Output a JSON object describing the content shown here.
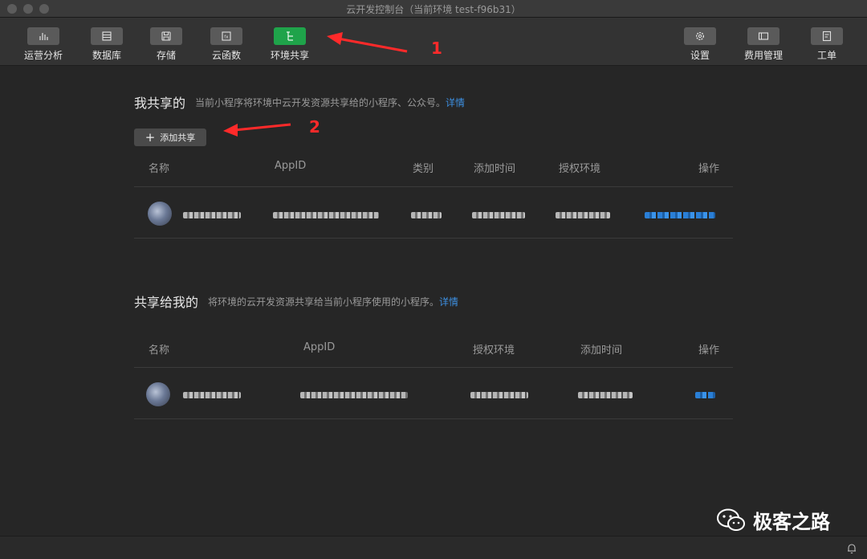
{
  "window": {
    "title": "云开发控制台（当前环境 test-f96b31）"
  },
  "toolbar": {
    "left": [
      {
        "label": "运营分析",
        "icon": "chart-icon"
      },
      {
        "label": "数据库",
        "icon": "database-icon"
      },
      {
        "label": "存储",
        "icon": "storage-icon"
      },
      {
        "label": "云函数",
        "icon": "function-icon"
      },
      {
        "label": "环境共享",
        "icon": "share-env-icon",
        "active": true
      }
    ],
    "right": [
      {
        "label": "设置",
        "icon": "gear-icon"
      },
      {
        "label": "费用管理",
        "icon": "billing-icon"
      },
      {
        "label": "工单",
        "icon": "ticket-icon"
      }
    ],
    "active_color": "#1fa34a"
  },
  "my_share": {
    "title": "我共享的",
    "desc": "当前小程序将环境中云开发资源共享给的小程序、公众号。",
    "detail_link": "详情",
    "add_button": "添加共享",
    "columns": [
      "名称",
      "AppID",
      "类别",
      "添加时间",
      "授权环境",
      "操作"
    ]
  },
  "shared_to_me": {
    "title": "共享给我的",
    "desc": "将环境的云开发资源共享给当前小程序使用的小程序。",
    "detail_link": "详情",
    "columns": [
      "名称",
      "AppID",
      "授权环境",
      "添加时间",
      "操作"
    ]
  },
  "annotations": {
    "one": "1",
    "two": "2",
    "color": "#ff2a2a"
  },
  "watermark": {
    "text": "极客之路"
  },
  "colors": {
    "link": "#3d8fe0",
    "background": "#262626"
  }
}
